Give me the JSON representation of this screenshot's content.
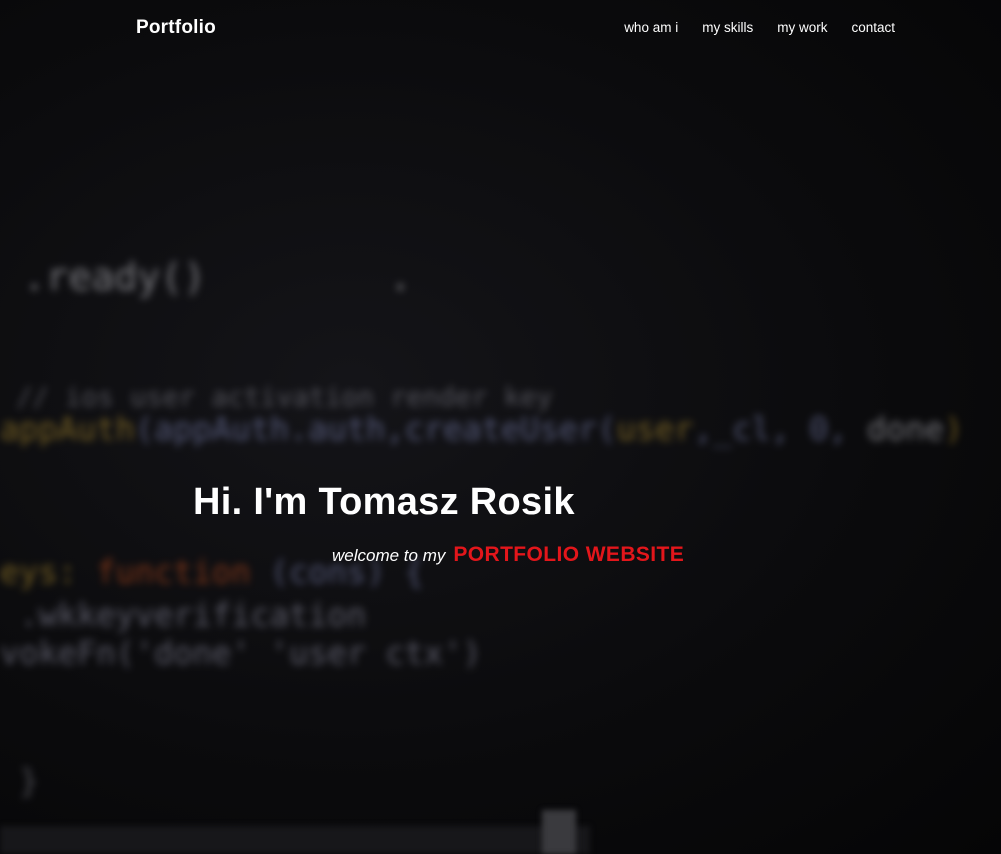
{
  "nav": {
    "brand": "Portfolio",
    "links": [
      "who am i",
      "my skills",
      "my work",
      "contact"
    ]
  },
  "hero": {
    "title": "Hi. I'm Tomasz Rosik",
    "welcome": "welcome to my",
    "highlight": "PORTFOLIO WEBSITE"
  },
  "colors": {
    "background": "#0a0a0b",
    "text": "#ffffff",
    "accent": "#e3161b"
  }
}
